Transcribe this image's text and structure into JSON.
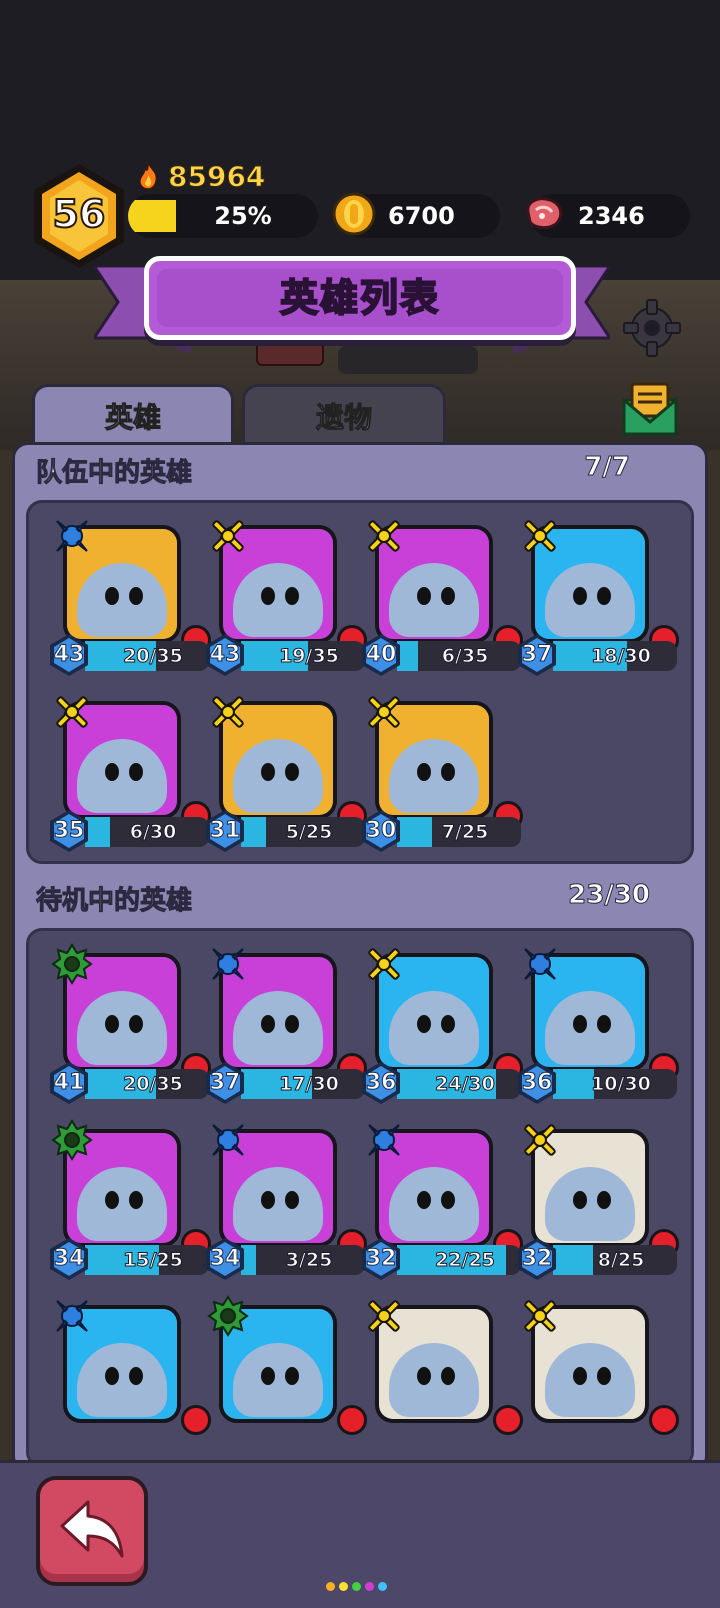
{
  "player": {
    "level": "56",
    "power": "85964",
    "exp_percent": "25%",
    "exp_fraction": 0.25,
    "gold": "6700",
    "meat": "2346"
  },
  "header": {
    "title": "英雄列表"
  },
  "tabs": {
    "heroes": "英雄",
    "relics": "遗物"
  },
  "team": {
    "title": "队伍中的英雄",
    "count": "7/7",
    "heroes": [
      {
        "level": "43",
        "fragments": "20/35",
        "fill": 0.57,
        "class": "mage",
        "bg": "#f0b030"
      },
      {
        "level": "43",
        "fragments": "19/35",
        "fill": 0.54,
        "class": "warrior",
        "bg": "#c840d8"
      },
      {
        "level": "40",
        "fragments": "6/35",
        "fill": 0.17,
        "class": "warrior",
        "bg": "#c840d8"
      },
      {
        "level": "37",
        "fragments": "18/30",
        "fill": 0.6,
        "class": "warrior",
        "bg": "#2ab4f0"
      },
      {
        "level": "35",
        "fragments": "6/30",
        "fill": 0.2,
        "class": "warrior",
        "bg": "#c840d8"
      },
      {
        "level": "31",
        "fragments": "5/25",
        "fill": 0.2,
        "class": "warrior",
        "bg": "#f0b030"
      },
      {
        "level": "30",
        "fragments": "7/25",
        "fill": 0.28,
        "class": "warrior",
        "bg": "#f0b030"
      }
    ]
  },
  "standby": {
    "title": "待机中的英雄",
    "count": "23/30",
    "heroes": [
      {
        "level": "41",
        "fragments": "20/35",
        "fill": 0.57,
        "class": "support",
        "bg": "#c840d8"
      },
      {
        "level": "37",
        "fragments": "17/30",
        "fill": 0.57,
        "class": "mage",
        "bg": "#c840d8"
      },
      {
        "level": "36",
        "fragments": "24/30",
        "fill": 0.8,
        "class": "warrior",
        "bg": "#2ab4f0"
      },
      {
        "level": "36",
        "fragments": "10/30",
        "fill": 0.33,
        "class": "mage",
        "bg": "#2ab4f0"
      },
      {
        "level": "34",
        "fragments": "15/25",
        "fill": 0.6,
        "class": "support",
        "bg": "#c840d8"
      },
      {
        "level": "34",
        "fragments": "3/25",
        "fill": 0.12,
        "class": "mage",
        "bg": "#c840d8"
      },
      {
        "level": "32",
        "fragments": "22/25",
        "fill": 0.88,
        "class": "mage",
        "bg": "#c840d8"
      },
      {
        "level": "32",
        "fragments": "8/25",
        "fill": 0.32,
        "class": "warrior",
        "bg": "#e8e2d4"
      },
      {
        "level": "",
        "fragments": "",
        "fill": 0,
        "class": "mage",
        "bg": "#2ab4f0"
      },
      {
        "level": "",
        "fragments": "",
        "fill": 0,
        "class": "support",
        "bg": "#2ab4f0"
      },
      {
        "level": "",
        "fragments": "",
        "fill": 0,
        "class": "warrior",
        "bg": "#e8e2d4"
      },
      {
        "level": "",
        "fragments": "",
        "fill": 0,
        "class": "warrior",
        "bg": "#e8e2d4"
      }
    ]
  },
  "colors": {
    "class_mage": "#2f7fe0",
    "class_warrior": "#f4d21a",
    "class_support": "#2f9a3a",
    "accent_purple": "#b35ad6"
  },
  "icons": [
    "flame-icon",
    "gold-coin-icon",
    "meat-icon",
    "gear-icon",
    "mail-icon",
    "back-arrow-icon"
  ]
}
